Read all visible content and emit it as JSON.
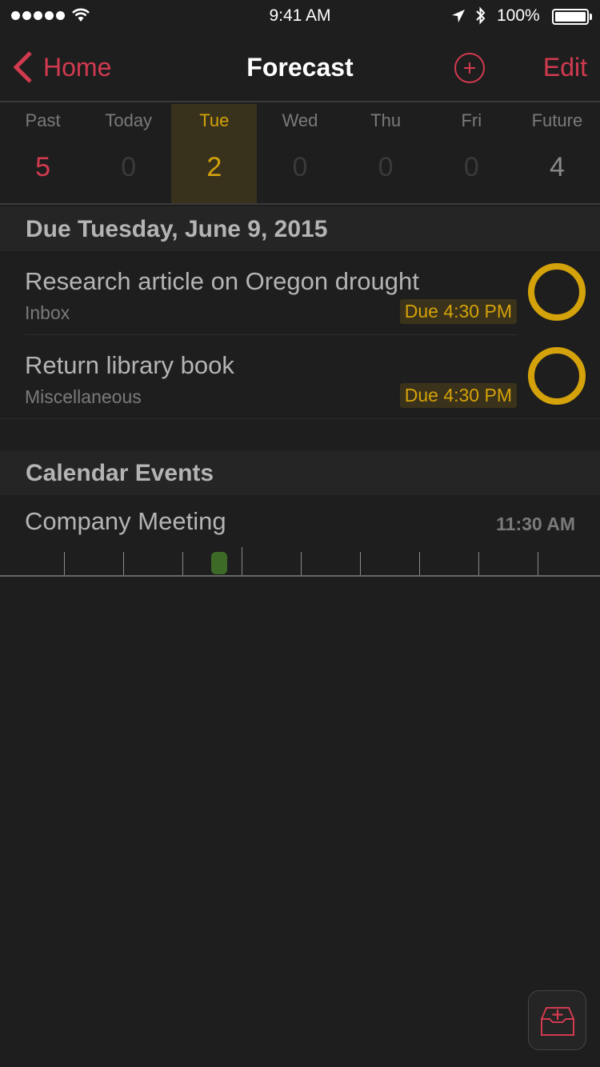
{
  "status_bar": {
    "time": "9:41 AM",
    "battery_percent": "100%",
    "signal_bars": 5,
    "icons": [
      "signal-dots-icon",
      "wifi-icon",
      "location-arrow-icon",
      "bluetooth-icon",
      "battery-icon"
    ]
  },
  "nav": {
    "back_label": "Home",
    "title": "Forecast",
    "add_icon": "plus-circle-icon",
    "edit_label": "Edit"
  },
  "forecast": {
    "days": [
      {
        "label": "Past",
        "count": "5",
        "state": "past"
      },
      {
        "label": "Today",
        "count": "0",
        "state": "empty"
      },
      {
        "label": "Tue",
        "count": "2",
        "state": "selected"
      },
      {
        "label": "Wed",
        "count": "0",
        "state": "empty"
      },
      {
        "label": "Thu",
        "count": "0",
        "state": "empty"
      },
      {
        "label": "Fri",
        "count": "0",
        "state": "empty"
      },
      {
        "label": "Future",
        "count": "4",
        "state": "future"
      }
    ]
  },
  "due_section": {
    "header": "Due Tuesday, June 9, 2015",
    "tasks": [
      {
        "title": "Research article on Oregon drought",
        "project": "Inbox",
        "due": "Due 4:30 PM"
      },
      {
        "title": "Return library book",
        "project": "Miscellaneous",
        "due": "Due 4:30 PM"
      }
    ]
  },
  "calendar_section": {
    "header": "Calendar Events",
    "events": [
      {
        "title": "Company Meeting",
        "time": "11:30 AM"
      }
    ]
  },
  "quick_entry": {
    "icon": "inbox-add-icon"
  },
  "colors": {
    "accent_red": "#d23a50",
    "due_yellow": "#d4a20a",
    "event_green": "#3d6b27",
    "background": "#1e1e1e"
  }
}
